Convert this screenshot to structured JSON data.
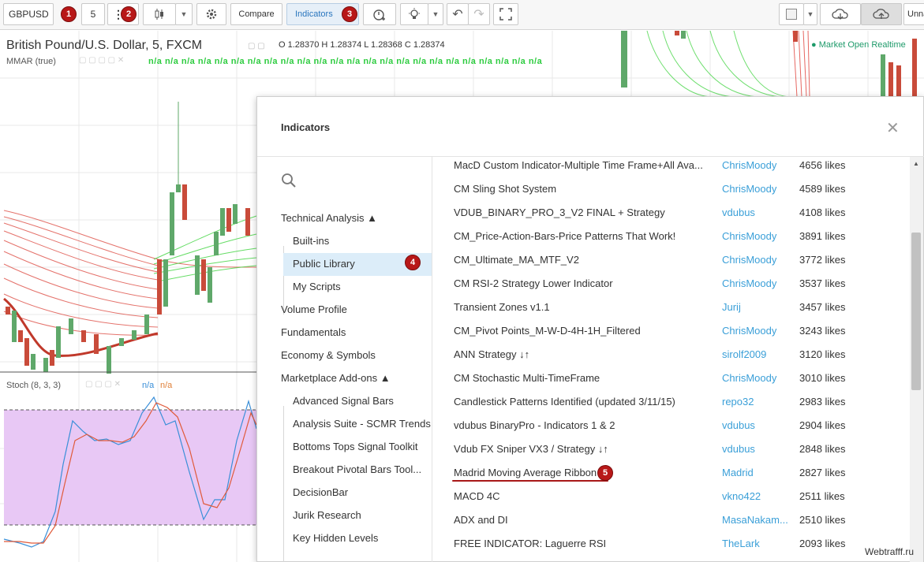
{
  "toolbar": {
    "symbol": "GBPUSD",
    "interval": "5",
    "compare_label": "Compare",
    "indicators_label": "Indicators",
    "user_label": "Unna",
    "badges": [
      "1",
      "2",
      "3"
    ]
  },
  "chart": {
    "title": "British Pound/U.S. Dollar, 5, FXCM",
    "ohlc": "O 1.28370  H 1.28374  L 1.28368  C 1.28374",
    "market_status": "● Market Open  Realtime",
    "mmar_label": "MMAR (true)",
    "na_values": "n/a n/a n/a n/a n/a n/a n/a n/a n/a n/a n/a n/a n/a n/a n/a n/a n/a n/a n/a n/a n/a n/a n/a n/a",
    "stoch_label": "Stoch (8, 3, 3)",
    "stoch_k": "n/a",
    "stoch_d": "n/a",
    "colors": {
      "up": "#5fa86a",
      "down": "#c94b3a",
      "ribbon_red": "#e0413a",
      "ribbon_green": "#3bd13b",
      "stoch_band": "#e8c8f5"
    }
  },
  "modal": {
    "title": "Indicators",
    "badges": [
      "4",
      "5"
    ],
    "nav": [
      {
        "label": "Technical Analysis ▲",
        "level": 0
      },
      {
        "label": "Built-ins",
        "level": 1
      },
      {
        "label": "Public Library",
        "level": 1,
        "active": true
      },
      {
        "label": "My Scripts",
        "level": 1
      },
      {
        "label": "Volume Profile",
        "level": 0
      },
      {
        "label": "Fundamentals",
        "level": 0
      },
      {
        "label": "Economy & Symbols",
        "level": 0
      },
      {
        "label": "Marketplace Add-ons ▲",
        "level": 0
      },
      {
        "label": "Advanced Signal Bars",
        "level": 1
      },
      {
        "label": "Analysis Suite - SCMR Trends",
        "level": 1
      },
      {
        "label": "Bottoms Tops Signal Toolkit",
        "level": 1
      },
      {
        "label": "Breakout Pivotal Bars Tool...",
        "level": 1
      },
      {
        "label": "DecisionBar",
        "level": 1
      },
      {
        "label": "Jurik Research",
        "level": 1
      },
      {
        "label": "Key Hidden Levels",
        "level": 1
      }
    ],
    "indicators": [
      {
        "name": "MacD Custom Indicator-Multiple Time Frame+All Ava...",
        "author": "ChrisMoody",
        "likes": "4656 likes"
      },
      {
        "name": "CM Sling Shot System",
        "author": "ChrisMoody",
        "likes": "4589 likes"
      },
      {
        "name": "VDUB_BINARY_PRO_3_V2 FINAL + Strategy",
        "author": "vdubus",
        "likes": "4108 likes"
      },
      {
        "name": "CM_Price-Action-Bars-Price Patterns That Work!",
        "author": "ChrisMoody",
        "likes": "3891 likes"
      },
      {
        "name": "CM_Ultimate_MA_MTF_V2",
        "author": "ChrisMoody",
        "likes": "3772 likes"
      },
      {
        "name": "CM RSI-2 Strategy Lower Indicator",
        "author": "ChrisMoody",
        "likes": "3537 likes"
      },
      {
        "name": "Transient Zones v1.1",
        "author": "Jurij",
        "likes": "3457 likes"
      },
      {
        "name": "CM_Pivot Points_M-W-D-4H-1H_Filtered",
        "author": "ChrisMoody",
        "likes": "3243 likes"
      },
      {
        "name": "ANN Strategy ↓↑",
        "author": "sirolf2009",
        "likes": "3120 likes"
      },
      {
        "name": "CM Stochastic Multi-TimeFrame",
        "author": "ChrisMoody",
        "likes": "3010 likes"
      },
      {
        "name": "Candlestick Patterns Identified (updated 3/11/15)",
        "author": "repo32",
        "likes": "2983 likes"
      },
      {
        "name": "vdubus BinaryPro - Indicators 1 & 2",
        "author": "vdubus",
        "likes": "2904 likes"
      },
      {
        "name": "Vdub FX Sniper VX3 / Strategy ↓↑",
        "author": "vdubus",
        "likes": "2848 likes"
      },
      {
        "name": "Madrid Moving Average Ribbon",
        "author": "Madrid",
        "likes": "2827 likes",
        "highlight": true
      },
      {
        "name": "MACD 4C",
        "author": "vkno422",
        "likes": "2511 likes"
      },
      {
        "name": "ADX and DI",
        "author": "MasaNakam...",
        "likes": "2510 likes"
      },
      {
        "name": "FREE INDICATOR: Laguerre RSI",
        "author": "TheLark",
        "likes": "2093 likes"
      }
    ]
  },
  "watermark": "Webtrafff.ru"
}
